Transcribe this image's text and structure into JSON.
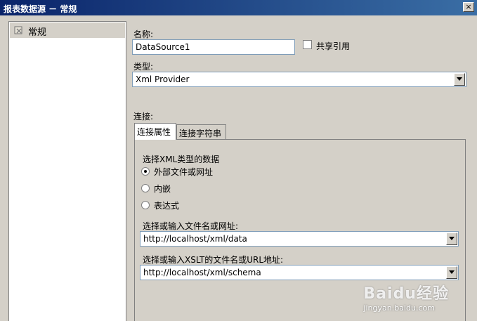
{
  "window": {
    "title": "报表数据源 － 常规",
    "close_label": "×"
  },
  "sidebar": {
    "items": [
      {
        "label": "常规"
      }
    ]
  },
  "form": {
    "name_label": "名称:",
    "name_value": "DataSource1",
    "shared_label": "共享引用",
    "type_label": "类型:",
    "type_value": "Xml Provider",
    "connection_label": "连接:",
    "tabs": [
      {
        "label": "连接属性"
      },
      {
        "label": "连接字符串"
      }
    ],
    "xml_type_label": "选择XML类型的数据",
    "radio_options": [
      {
        "label": "外部文件或网址",
        "checked": true
      },
      {
        "label": "内嵌"
      },
      {
        "label": "表达式"
      }
    ],
    "file_label": "选择或输入文件名或网址:",
    "file_value": "http://localhost/xml/data",
    "xslt_label": "选择或输入XSLT的文件名或URL地址:",
    "xslt_value": "http://localhost/xml/schema"
  },
  "watermark": {
    "logo": "Baidu经验",
    "url": "jingyan.baidu.com"
  }
}
